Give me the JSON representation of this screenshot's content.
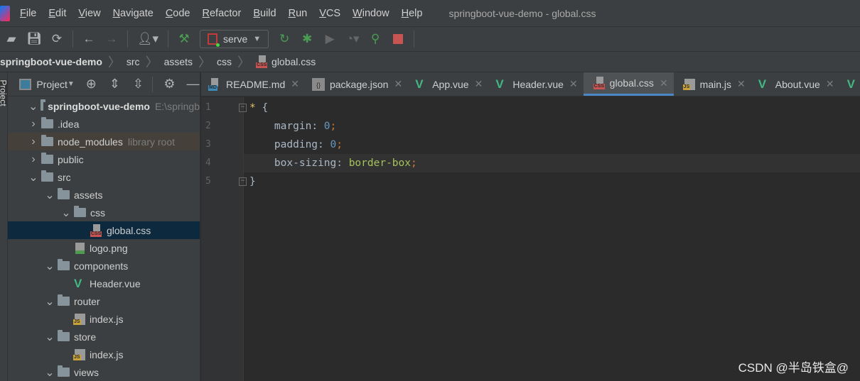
{
  "menu": [
    "File",
    "Edit",
    "View",
    "Navigate",
    "Code",
    "Refactor",
    "Build",
    "Run",
    "VCS",
    "Window",
    "Help"
  ],
  "window_title": "springboot-vue-demo - global.css",
  "toolbar": {
    "run_config": "serve"
  },
  "breadcrumb": [
    "springboot-vue-demo",
    "src",
    "assets",
    "css",
    "global.css"
  ],
  "panel": {
    "stripe_label": "Project",
    "title": "Project"
  },
  "tree": [
    {
      "label": "springboot-vue-demo",
      "hint": "E:\\springb",
      "type": "folder",
      "level": 0,
      "expanded": true
    },
    {
      "label": ".idea",
      "type": "folder",
      "level": 1,
      "expanded": false
    },
    {
      "label": "node_modules",
      "hint": "library root",
      "type": "folder",
      "level": 1,
      "expanded": false
    },
    {
      "label": "public",
      "type": "folder",
      "level": 1,
      "expanded": false
    },
    {
      "label": "src",
      "type": "folder",
      "level": 1,
      "expanded": true
    },
    {
      "label": "assets",
      "type": "folder",
      "level": 2,
      "expanded": true
    },
    {
      "label": "css",
      "type": "folder",
      "level": 3,
      "expanded": true
    },
    {
      "label": "global.css",
      "type": "css",
      "level": 4,
      "selected": true
    },
    {
      "label": "logo.png",
      "type": "png",
      "level": 3
    },
    {
      "label": "components",
      "type": "folder",
      "level": 2,
      "expanded": true
    },
    {
      "label": "Header.vue",
      "type": "vue",
      "level": 3
    },
    {
      "label": "router",
      "type": "folder",
      "level": 2,
      "expanded": true
    },
    {
      "label": "index.js",
      "type": "js",
      "level": 3
    },
    {
      "label": "store",
      "type": "folder",
      "level": 2,
      "expanded": true
    },
    {
      "label": "index.js",
      "type": "js",
      "level": 3
    },
    {
      "label": "views",
      "type": "folder",
      "level": 2,
      "expanded": true
    }
  ],
  "tabs": [
    {
      "label": "README.md",
      "type": "md"
    },
    {
      "label": "package.json",
      "type": "json"
    },
    {
      "label": "App.vue",
      "type": "vue"
    },
    {
      "label": "Header.vue",
      "type": "vue"
    },
    {
      "label": "global.css",
      "type": "css",
      "active": true
    },
    {
      "label": "main.js",
      "type": "js"
    },
    {
      "label": "About.vue",
      "type": "vue"
    },
    {
      "label": "H",
      "type": "vue"
    }
  ],
  "code": {
    "line_numbers": [
      "1",
      "2",
      "3",
      "4",
      "5"
    ],
    "selector": "*",
    "open": " {",
    "props": [
      {
        "name": "margin",
        "value": "0"
      },
      {
        "name": "padding",
        "value": "0"
      },
      {
        "name": "box-sizing",
        "value": "border-box"
      }
    ],
    "close": "}"
  },
  "watermark": "CSDN @半岛铁盒@"
}
